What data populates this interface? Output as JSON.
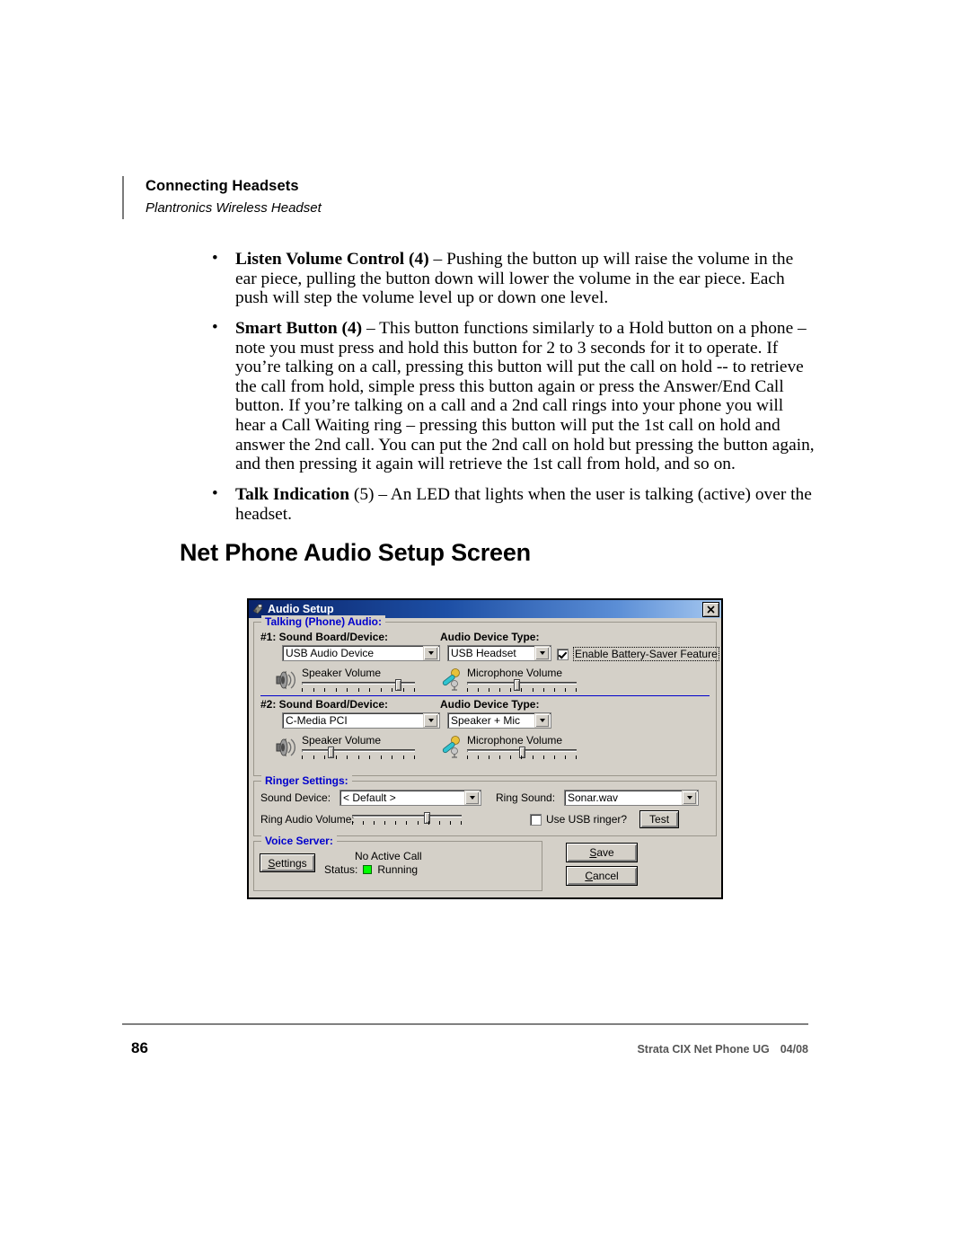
{
  "header": {
    "title": "Connecting Headsets",
    "subtitle": "Plantronics Wireless Headset"
  },
  "body": {
    "bullets": [
      {
        "term": "Listen Volume Control",
        "ref": "(4)",
        "text": " – Pushing the button up will raise the volume in the ear piece, pulling the button down will lower the volume in the ear piece.  Each push will step the volume level up or down one level."
      },
      {
        "term": "Smart Button",
        "ref": "(4)",
        "text": " – This button functions similarly to a Hold button on a phone – note you must press and hold this button for 2 to 3 seconds for it to operate.   If you’re talking on a call, pressing this button will put the call on hold -- to retrieve the call from hold, simple press this button again or press the Answer/End Call button.   If you’re talking on a call and a 2nd call rings into your phone you will hear a Call Waiting ring – pressing this button will put the 1st call on hold and answer the 2nd call.   You can put the 2nd call on hold but pressing the button again, and then pressing it again will retrieve the 1st call from hold, and so on."
      },
      {
        "term": "Talk Indication",
        "ref": "(5)",
        "text": " – An LED that lights when the user is talking (active) over the headset."
      }
    ],
    "bullet_char": "•"
  },
  "section_heading": "Net Phone Audio Setup Screen",
  "dialog": {
    "title": "Audio Setup",
    "close_label": "✕",
    "talking_group": {
      "legend": "Talking (Phone) Audio:",
      "device1": {
        "board_label": "#1:  Sound Board/Device:",
        "board_value": "USB Audio Device",
        "type_label": "Audio Device Type:",
        "type_value": "USB Headset",
        "battery_saver_label": "Enable Battery-Saver Feature",
        "battery_saver_checked": true,
        "speaker_label": "Speaker  Volume",
        "speaker_value": 85,
        "mic_label": "Microphone  Volume",
        "mic_value": 45
      },
      "device2": {
        "board_label": "#2:  Sound Board/Device:",
        "board_value": "C-Media PCI",
        "type_label": "Audio Device Type:",
        "type_value": "Speaker + Mic",
        "speaker_label": "Speaker  Volume",
        "speaker_value": 25,
        "mic_label": "Microphone  Volume",
        "mic_value": 50
      }
    },
    "ringer_group": {
      "legend": "Ringer Settings:",
      "sound_device_label": "Sound Device:",
      "sound_device_value": "< Default >",
      "ring_sound_label": "Ring Sound:",
      "ring_sound_value": "Sonar.wav",
      "ring_volume_label": "Ring Audio Volume:",
      "ring_volume_value": 68,
      "usb_ringer_label": "Use USB ringer?",
      "usb_ringer_checked": false,
      "test_button": "Test"
    },
    "voice_group": {
      "legend": "Voice Server:",
      "settings_button": "Settings",
      "status_label": "Status:",
      "call_state": "No Active Call",
      "status_value": "Running",
      "status_color": "#00ff00"
    },
    "save_button": "Save",
    "cancel_button": "Cancel"
  },
  "footer": {
    "page_number": "86",
    "doc_title": "Strata CIX Net Phone UG",
    "date": "04/08"
  }
}
